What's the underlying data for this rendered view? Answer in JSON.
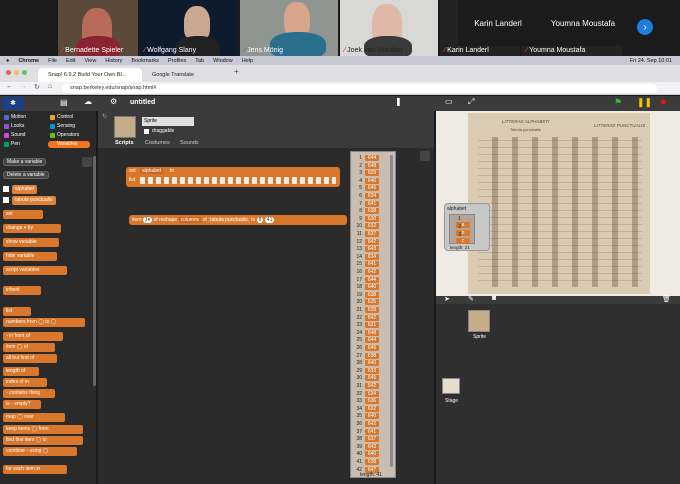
{
  "participants": [
    {
      "name": "Bernadette Spieler"
    },
    {
      "name": "Wolfgang Slany"
    },
    {
      "name": "Jens Mönig"
    },
    {
      "name": "Joek van Montfort"
    },
    {
      "name": "Karin Landerl"
    },
    {
      "name": "Youmna Moustafa"
    }
  ],
  "top_names": [
    "Karin Landerl",
    "Youmna Moustafa"
  ],
  "menubar": [
    "Chrome",
    "File",
    "Edit",
    "View",
    "History",
    "Bookmarks",
    "Profiles",
    "Tab",
    "Window",
    "Help"
  ],
  "clock": "Fri 24. Sep 10:01",
  "tabs": [
    "Snap! 6.9.2 Build Your Own Bl...",
    "Google Translate"
  ],
  "url": "snap.berkeley.edu/snap/snap.html#",
  "project_title": "untitled",
  "categories": [
    {
      "label": "Motion",
      "color": "#4a6cd4"
    },
    {
      "label": "Control",
      "color": "#e6a822"
    },
    {
      "label": "Looks",
      "color": "#8f56e3"
    },
    {
      "label": "Sensing",
      "color": "#0494dc"
    },
    {
      "label": "Sound",
      "color": "#cf4ad9"
    },
    {
      "label": "Operators",
      "color": "#62c213"
    },
    {
      "label": "Pen",
      "color": "#00a178"
    },
    {
      "label": "Variables",
      "color": "#f3761d"
    }
  ],
  "palette_buttons": {
    "make": "Make a variable",
    "delete": "Delete a variable"
  },
  "variables": [
    "alphabet",
    "tabula punctualis"
  ],
  "palette_blocks": [
    "set",
    "change",
    "by",
    "show variable",
    "hide variable",
    "script variables",
    "inherit",
    "list",
    "numbers from",
    "to",
    "in front of",
    "item",
    "of",
    "all but first of",
    "length of",
    "index of",
    "in",
    "contains",
    "thing",
    "is",
    "empty?",
    "map",
    "over",
    "keep items",
    "from",
    "find first item",
    "in",
    "combine",
    "using",
    "for each",
    "item",
    "in"
  ],
  "sprite": {
    "name": "Sprite",
    "draggable": "draggable",
    "tabs": [
      "Scripts",
      "Costumes",
      "Sounds"
    ]
  },
  "script1": {
    "set": "set",
    "var": "alphabet",
    "to": "to",
    "list": "list"
  },
  "script2": {
    "item": "item",
    "of": "of",
    "reshape": "reshape",
    "columns": "columns",
    "of2": "of",
    "tabula": "tabula punctualis",
    "to": "to",
    "a": "8",
    "b": "41"
  },
  "list_values": [
    "644",
    "648",
    "629",
    "640",
    "646",
    "634",
    "641",
    "638",
    "630",
    "632",
    "637",
    "642",
    "643",
    "634",
    "641",
    "642",
    "644",
    "640",
    "638",
    "635",
    "639",
    "642",
    "631",
    "648",
    "644",
    "646",
    "638",
    "640",
    "633",
    "645",
    "642",
    "634",
    "636",
    "632",
    "640",
    "642",
    "641",
    "637",
    "643",
    "640",
    "638",
    "647"
  ],
  "list_footer": "length: 41",
  "stage_watcher": {
    "title": "alphabet",
    "items": [
      "a",
      "b",
      "c"
    ],
    "length": "length: 21"
  },
  "stage_doc": {
    "heading1": "LITTERAE ALPHABETI",
    "heading2": "LITTERAE PUNCTUALIS",
    "sub": "Tabula punctualis"
  },
  "corral": {
    "sprite_label": "Sprite",
    "stage_label": "Stage"
  }
}
